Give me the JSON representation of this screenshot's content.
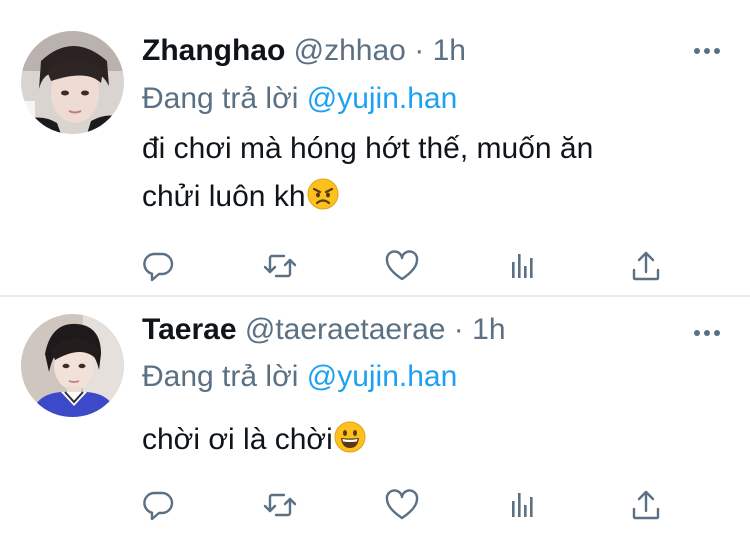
{
  "tweets": [
    {
      "name": "Zhanghao",
      "handle": "@zhhao",
      "separator": "·",
      "time": "1h",
      "reply_prefix": "Đang trả lời",
      "reply_to": "@yujin.han",
      "text_line1": "đi chơi mà hóng hớt thế, muốn ăn",
      "text_line2": "chửi luôn kh",
      "emoji": "angry-face-icon"
    },
    {
      "name": "Taerae",
      "handle": "@taeraetaerae",
      "separator": "·",
      "time": "1h",
      "reply_prefix": "Đang trả lời",
      "reply_to": "@yujin.han",
      "text_line1": "chời ơi là chời",
      "emoji": "grinning-face-icon"
    }
  ],
  "actions": [
    "reply-icon",
    "retweet-icon",
    "like-icon",
    "analytics-icon",
    "share-icon"
  ],
  "colors": {
    "text": "#0f1419",
    "secondary": "#5b7083",
    "link": "#1da1f2",
    "divider": "#e6ecf0"
  }
}
